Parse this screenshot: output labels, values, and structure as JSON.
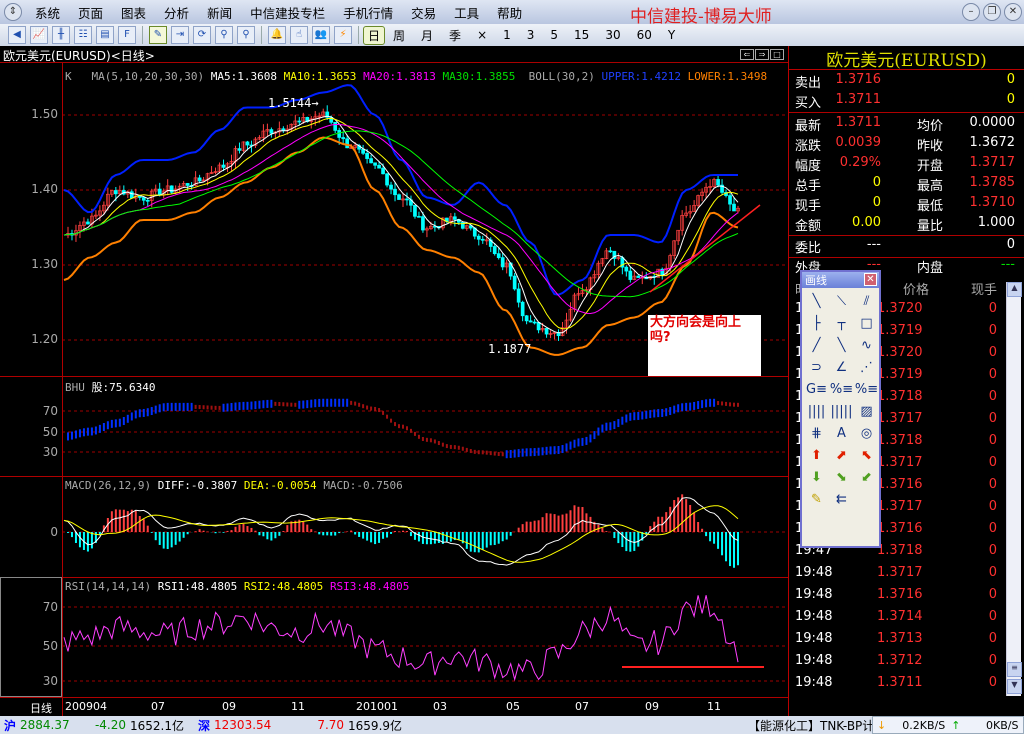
{
  "menu": [
    "系统",
    "页面",
    "图表",
    "分析",
    "新闻",
    "中信建投专栏",
    "手机行情",
    "交易",
    "工具",
    "帮助"
  ],
  "brand": "中信建投-博易大师",
  "toolbar": {
    "periods": [
      "日",
      "周",
      "月",
      "季",
      "×",
      "1",
      "3",
      "5",
      "15",
      "30",
      "60",
      "Y"
    ],
    "selected_period": "日"
  },
  "chart": {
    "title": "欧元美元(EURUSD)<日线>",
    "ma_label": "MA(5,10,20,30,30)",
    "ma5": "MA5:1.3608",
    "ma10": "MA10:1.3653",
    "ma20": "MA20:1.3813",
    "ma30": "MA30:1.3855",
    "boll_label": "BOLL(30,2)",
    "upper": "UPPER:1.4212",
    "lower": "LOWER:1.3498",
    "k": "K",
    "y_ticks": [
      "1.50",
      "1.40",
      "1.30",
      "1.20"
    ],
    "high_label": "1.5144",
    "low_label": "1.1877",
    "bhu_label": "BHU",
    "bhu_value": "股:75.6340",
    "bhu_ticks": [
      "70",
      "50",
      "30"
    ],
    "macd_label": "MACD(26,12,9)",
    "diff": "DIFF:-0.3807",
    "dea": "DEA:-0.0054",
    "macd": "MACD:-0.7506",
    "macd_tick": "0",
    "rsi_label": "RSI(14,14,14)",
    "rsi1": "RSI1:48.4805",
    "rsi2": "RSI2:48.4805",
    "rsi3": "RSI3:48.4805",
    "rsi_ticks": [
      "70",
      "50",
      "30"
    ],
    "period_label": "日线",
    "dates": [
      "200904",
      "07",
      "09",
      "11",
      "201001",
      "03",
      "05",
      "07",
      "09",
      "11"
    ],
    "annotation": "大方向会是向上吗?",
    "colors": {
      "up": "#ff4040",
      "down": "#00ffff",
      "ma5": "#ffffff",
      "ma10": "#ffff00",
      "ma20": "#ff00ff",
      "ma30": "#00ff00",
      "upper": "#0020ff",
      "lower": "#ff8000"
    }
  },
  "chart_data": {
    "type": "line",
    "close": [
      1.34,
      1.36,
      1.4,
      1.39,
      1.4,
      1.41,
      1.43,
      1.46,
      1.48,
      1.49,
      1.5,
      1.46,
      1.43,
      1.39,
      1.35,
      1.36,
      1.34,
      1.3,
      1.22,
      1.21,
      1.27,
      1.32,
      1.28,
      1.29,
      1.37,
      1.41,
      1.37
    ],
    "upper": [
      1.4,
      1.37,
      1.42,
      1.44,
      1.44,
      1.45,
      1.48,
      1.51,
      1.51,
      1.52,
      1.53,
      1.54,
      1.5,
      1.44,
      1.39,
      1.38,
      1.41,
      1.38,
      1.33,
      1.26,
      1.28,
      1.34,
      1.34,
      1.33,
      1.4,
      1.42,
      1.42
    ],
    "lower": [
      1.28,
      1.31,
      1.33,
      1.36,
      1.36,
      1.37,
      1.39,
      1.41,
      1.43,
      1.45,
      1.47,
      1.46,
      1.4,
      1.35,
      1.32,
      1.31,
      1.29,
      1.24,
      1.19,
      1.18,
      1.19,
      1.22,
      1.23,
      1.25,
      1.3,
      1.37,
      1.35
    ],
    "bhu": [
      45,
      50,
      58,
      68,
      74,
      74,
      73,
      75,
      77,
      76,
      78,
      78,
      72,
      55,
      42,
      35,
      30,
      28,
      30,
      32,
      40,
      55,
      65,
      68,
      74,
      78,
      76
    ],
    "diff": [
      0.5,
      -0.6,
      0.6,
      1.0,
      0.2,
      0.4,
      0.3,
      0.6,
      0.2,
      0.8,
      0.5,
      0.6,
      0.1,
      0.3,
      -0.3,
      -0.5,
      -1.3,
      -1.5,
      -1.0,
      -0.4,
      0.5,
      0.3,
      -0.5,
      0.3,
      1.6,
      0.9,
      -0.4
    ],
    "rsi": [
      52,
      55,
      60,
      58,
      56,
      60,
      62,
      66,
      60,
      58,
      62,
      55,
      48,
      44,
      40,
      45,
      42,
      38,
      36,
      45,
      58,
      66,
      50,
      52,
      70,
      72,
      48
    ]
  },
  "quote": {
    "title": "欧元美元(EURUSD)",
    "rows": [
      [
        "卖出",
        "1.3716",
        "",
        "0"
      ],
      [
        "买入",
        "1.3711",
        "",
        "0"
      ],
      [
        "最新",
        "1.3711",
        "均价",
        "0.0000"
      ],
      [
        "涨跌",
        "0.0039",
        "昨收",
        "1.3672"
      ],
      [
        "幅度",
        "0.29%",
        "开盘",
        "1.3717"
      ],
      [
        "总手",
        "0",
        "最高",
        "1.3785"
      ],
      [
        "现手",
        "0",
        "最低",
        "1.3710"
      ],
      [
        "金额",
        "0.00",
        "量比",
        "1.000"
      ],
      [
        "委比",
        "---",
        "",
        "0"
      ],
      [
        "外盘",
        "---",
        "内盘",
        "---"
      ]
    ],
    "tick_headers": [
      "时间",
      "价格",
      "现手"
    ],
    "ticks": [
      [
        "19:47",
        "1.3720",
        "0"
      ],
      [
        "19:47",
        "1.3719",
        "0"
      ],
      [
        "19:47",
        "1.3720",
        "0"
      ],
      [
        "19:47",
        "1.3719",
        "0"
      ],
      [
        "19:47",
        "1.3718",
        "0"
      ],
      [
        "19:47",
        "1.3717",
        "0"
      ],
      [
        "19:47",
        "1.3718",
        "0"
      ],
      [
        "19:47",
        "1.3717",
        "0"
      ],
      [
        "19:47",
        "1.3716",
        "0"
      ],
      [
        "19:47",
        "1.3717",
        "0"
      ],
      [
        "19:47",
        "1.3716",
        "0"
      ],
      [
        "19:47",
        "1.3718",
        "0"
      ],
      [
        "19:48",
        "1.3717",
        "0"
      ],
      [
        "19:48",
        "1.3716",
        "0"
      ],
      [
        "19:48",
        "1.3714",
        "0"
      ],
      [
        "19:48",
        "1.3713",
        "0"
      ],
      [
        "19:48",
        "1.3712",
        "0"
      ],
      [
        "19:48",
        "1.3711",
        "0"
      ]
    ]
  },
  "palette": {
    "title": "画线",
    "tools": [
      "╲",
      "⟍",
      "⫽",
      "├",
      "┬",
      "□",
      "╱",
      "╲",
      "∿",
      "⊃",
      "∠",
      "⋰",
      "G≡",
      "%≡",
      "%≡",
      "||||",
      "|||||",
      "▨",
      "⋕",
      "A",
      "◎",
      "⬆",
      "⬈",
      "⬉",
      "⬇",
      "⬊",
      "⬋",
      "✎",
      "⇇"
    ]
  },
  "status": {
    "sh_label": "沪",
    "sh_index": "2884.37",
    "sh_change": "-4.20",
    "sh_amount": "1652.1亿",
    "sz_label": "深",
    "sz_index": "12303.54",
    "sz_change": "7.70",
    "sz_amount": "1659.9亿",
    "news": "【能源化工】TNK-BP计划",
    "down_speed": "0.2KB/S",
    "up_speed": "0KB/S"
  }
}
